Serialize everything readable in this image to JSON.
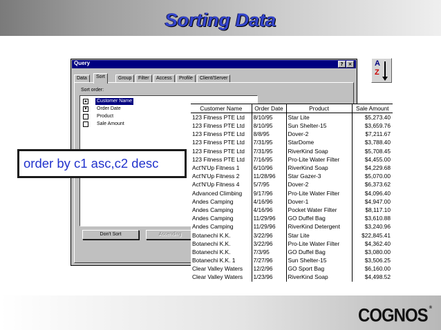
{
  "slide": {
    "title": "Sorting Data",
    "logo_text": "COGNOS",
    "logo_mark": "®"
  },
  "dialog": {
    "title": "Query",
    "title_buttons": {
      "help": "?",
      "close": "×"
    },
    "tabs": [
      "Data",
      "Sort",
      "Group",
      "Filter",
      "Access",
      "Profile",
      "Client/Server"
    ],
    "active_tab": "Sort",
    "sort_order_label": "Sort order:",
    "sort_items": [
      {
        "label": "Customer Name",
        "state": "asc",
        "selected": true
      },
      {
        "label": "Order Date",
        "state": "desc",
        "selected": false
      },
      {
        "label": "Product",
        "state": "none",
        "selected": false
      },
      {
        "label": "Sale Amount",
        "state": "none",
        "selected": false
      }
    ],
    "buttons": {
      "dont_sort": "Don't Sort",
      "ascending": "Ascending"
    }
  },
  "az_icon": {
    "top": "A",
    "bottom": "Z"
  },
  "callout": "order by c1 asc,c2 desc",
  "grid": {
    "columns": [
      "Customer Name",
      "Order Date",
      "Product",
      "Sale Amount"
    ],
    "rows": [
      [
        "123 Fitness PTE Ltd",
        "8/10/95",
        "Star Lite",
        "$5,273.40"
      ],
      [
        "123 Fitness PTE Ltd",
        "8/10/95",
        "Sun Shelter-15",
        "$3,659.76"
      ],
      [
        "123 Fitness PTE Ltd",
        "8/8/95",
        "Dover-2",
        "$7,211.67"
      ],
      [
        "123 Fitness PTE Ltd",
        "7/31/95",
        "StarDome",
        "$3,788.40"
      ],
      [
        "123 Fitness PTE Ltd",
        "7/31/95",
        "RiverKind Soap",
        "$5,708.45"
      ],
      [
        "123 Fitness PTE Ltd",
        "7/16/95",
        "Pro-Lite Water Filter",
        "$4,455.00"
      ],
      [
        "Act'N'Up Fitness 1",
        "6/10/96",
        "RiverKind Soap",
        "$4,229.68"
      ],
      [
        "Act'N'Up Fitness 2",
        "11/28/96",
        "Star Gazer-3",
        "$5,070.00"
      ],
      [
        "Act'N'Up Fitness 4",
        "5/7/95",
        "Dover-2",
        "$6,373.62"
      ],
      [
        "Advanced Climbing",
        "9/17/96",
        "Pro-Lite Water Filter",
        "$4,096.40"
      ],
      [
        "Andes Camping",
        "4/16/96",
        "Dover-1",
        "$4,947.00"
      ],
      [
        "Andes Camping",
        "4/16/96",
        "Pocket Water Filter",
        "$8,117.10"
      ],
      [
        "Andes Camping",
        "11/29/96",
        "GO Duffel Bag",
        "$3,610.88"
      ],
      [
        "Andes Camping",
        "11/29/96",
        "RiverKind Detergent",
        "$3,240.96"
      ],
      [
        "Botanechi K.K.",
        "3/22/96",
        "Star Lite",
        "$22,845.41"
      ],
      [
        "Botanechi K.K.",
        "3/22/96",
        "Pro-Lite Water Filter",
        "$4,362.40"
      ],
      [
        "Botanechi K.K.",
        "7/3/95",
        "GO Duffel Bag",
        "$3,080.00"
      ],
      [
        "Botanechi K.K. 1",
        "7/27/96",
        "Sun Shelter-15",
        "$3,506.25"
      ],
      [
        "Clear Valley Waters",
        "12/2/96",
        "GO Sport  Bag",
        "$6,160.00"
      ],
      [
        "Clear Valley Waters",
        "1/23/96",
        "RiverKind Soap",
        "$4,498.52"
      ]
    ]
  }
}
